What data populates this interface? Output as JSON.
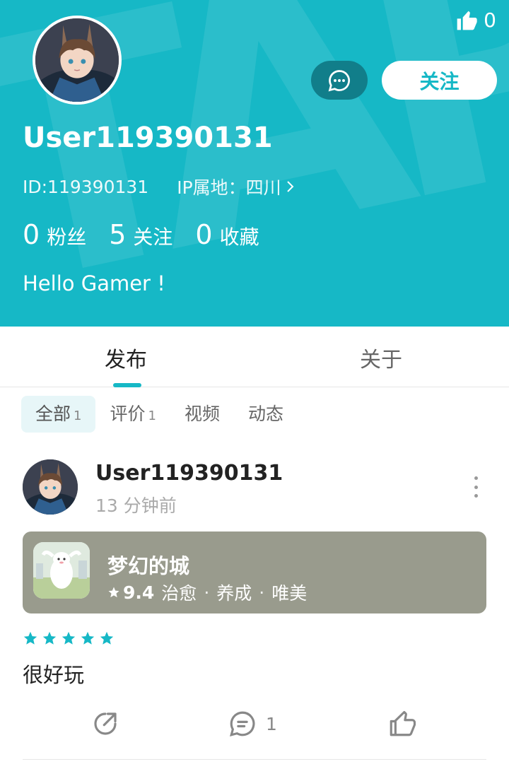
{
  "profile": {
    "like_count": "0",
    "follow_label": "关注",
    "username": "User119390131",
    "id_text": "ID:119390131",
    "ip_text": "IP属地：四川",
    "stats": [
      {
        "value": "0",
        "label": "粉丝"
      },
      {
        "value": "5",
        "label": "关注"
      },
      {
        "value": "0",
        "label": "收藏"
      }
    ],
    "bio": "Hello Gamer !"
  },
  "tabs": [
    {
      "label": "发布",
      "active": true
    },
    {
      "label": "关于",
      "active": false
    }
  ],
  "filters": [
    {
      "label": "全部",
      "count": "1",
      "active": true
    },
    {
      "label": "评价",
      "count": "1",
      "active": false
    },
    {
      "label": "视频",
      "count": "",
      "active": false
    },
    {
      "label": "动态",
      "count": "",
      "active": false
    }
  ],
  "post": {
    "username": "User119390131",
    "time": "13 分钟前",
    "game": {
      "title": "梦幻的城",
      "score": "9.4",
      "tags": [
        "治愈",
        "养成",
        "唯美"
      ]
    },
    "rating": 5,
    "rating_max": 5,
    "text": "很好玩",
    "comment_count": "1"
  },
  "colors": {
    "accent": "#16b8c6",
    "message_button": "#117e8a",
    "game_card": "#999b8d"
  },
  "icons": [
    "thumbs-up-icon",
    "chat-bubble-icon",
    "chevron-right-icon",
    "more-vertical-icon",
    "star-icon",
    "share-icon",
    "comment-icon",
    "like-icon"
  ]
}
